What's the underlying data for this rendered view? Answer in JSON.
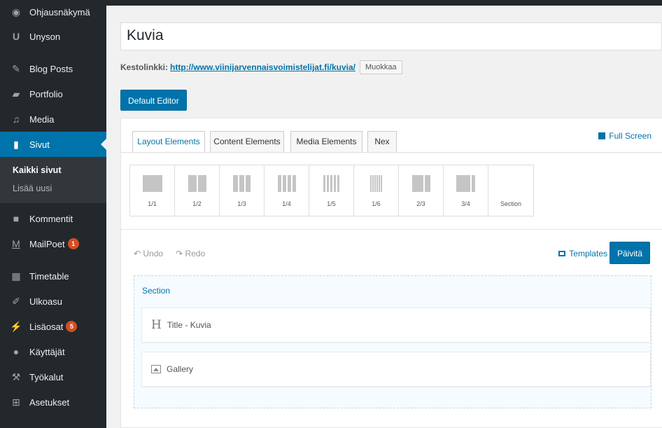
{
  "sidebar": {
    "items": [
      {
        "label": "Ohjausnäkymä",
        "icon": "dashboard-icon"
      },
      {
        "label": "Unyson",
        "icon": "unyson-icon"
      },
      {
        "label": "Blog Posts",
        "icon": "pin-icon"
      },
      {
        "label": "Portfolio",
        "icon": "folder-icon"
      },
      {
        "label": "Media",
        "icon": "media-icon"
      },
      {
        "label": "Sivut",
        "icon": "pages-icon"
      },
      {
        "label": "Kommentit",
        "icon": "comment-icon"
      },
      {
        "label": "MailPoet",
        "icon": "mailpoet-icon",
        "badge": "1"
      },
      {
        "label": "Timetable",
        "icon": "calendar-icon"
      },
      {
        "label": "Ulkoasu",
        "icon": "brush-icon"
      },
      {
        "label": "Lisäosat",
        "icon": "plugin-icon",
        "badge": "5"
      },
      {
        "label": "Käyttäjät",
        "icon": "user-icon"
      },
      {
        "label": "Työkalut",
        "icon": "wrench-icon"
      },
      {
        "label": "Asetukset",
        "icon": "settings-icon"
      }
    ],
    "submenu": {
      "current": "Kaikki sivut",
      "add_new": "Lisää uusi"
    }
  },
  "editor": {
    "title": "Kuvia",
    "permalink_label": "Kestolinkki:",
    "permalink_base": "http://www.viinijarvennaisvoimistelijat.fi/",
    "permalink_slug": "kuvia",
    "permalink_suffix": "/",
    "edit_button": "Muokkaa",
    "default_editor_button": "Default Editor"
  },
  "builder": {
    "tabs": [
      "Layout Elements",
      "Content Elements",
      "Media Elements",
      "Nex"
    ],
    "full_screen": "Full Screen",
    "layouts": [
      {
        "label": "1/1",
        "cols": 1
      },
      {
        "label": "1/2",
        "cols": 2
      },
      {
        "label": "1/3",
        "cols": 3
      },
      {
        "label": "1/4",
        "cols": 4
      },
      {
        "label": "1/5",
        "cols": 5
      },
      {
        "label": "1/6",
        "cols": 6
      },
      {
        "label": "2/3",
        "cols": "2/3"
      },
      {
        "label": "3/4",
        "cols": "3/4"
      },
      {
        "label": "Section",
        "cols": 0
      }
    ],
    "undo": "Undo",
    "redo": "Redo",
    "templates": "Templates",
    "update": "Päivitä",
    "section_label": "Section",
    "elements": [
      {
        "label": "Title - Kuvia",
        "icon": "heading-icon"
      },
      {
        "label": "Gallery",
        "icon": "image-icon"
      }
    ]
  },
  "colors": {
    "accent": "#0073aa",
    "sidebar_bg": "#23282d",
    "badge": "#d54e21"
  }
}
